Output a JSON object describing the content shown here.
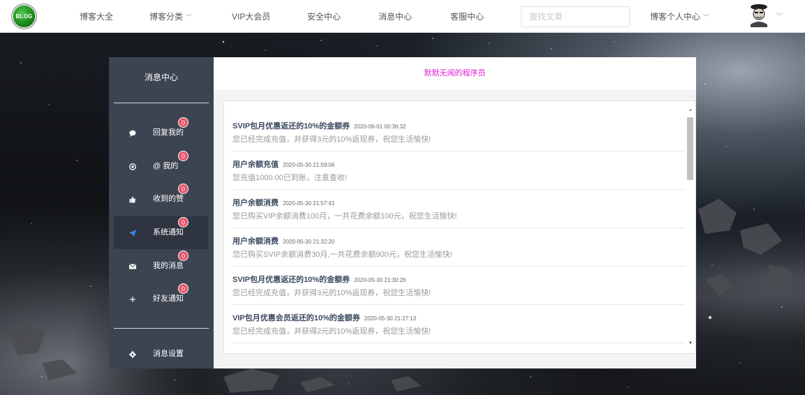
{
  "nav": {
    "logo_text": "BLOG",
    "items": [
      {
        "label": "博客大全",
        "has_caret": false
      },
      {
        "label": "博客分类",
        "has_caret": true
      },
      {
        "label": "VIP大会员",
        "has_caret": false
      },
      {
        "label": "安全中心",
        "has_caret": false
      },
      {
        "label": "消息中心",
        "has_caret": false
      },
      {
        "label": "客服中心",
        "has_caret": false
      }
    ],
    "caret_glyph": "﹀",
    "search_placeholder": "查找文章",
    "user_center_label": "博客个人中心",
    "avatar_icon": "user-avatar-icon"
  },
  "sidebar": {
    "title": "消息中心",
    "items": [
      {
        "label": "回复我的",
        "icon": "comment-icon",
        "badge": "0",
        "active": false
      },
      {
        "label": "@ 我的",
        "icon": "at-icon",
        "badge": "0",
        "active": false
      },
      {
        "label": "收到的赞",
        "icon": "thumbs-up-icon",
        "badge": "0",
        "active": false
      },
      {
        "label": "系统通知",
        "icon": "paper-plane-icon",
        "badge": "0",
        "active": true
      },
      {
        "label": "我的消息",
        "icon": "envelope-icon",
        "badge": "0",
        "active": false
      },
      {
        "label": "好友通知",
        "icon": "plus-icon",
        "badge": "0",
        "active": false
      }
    ],
    "settings_label": "消息设置",
    "settings_icon": "gear-icon"
  },
  "main": {
    "header": "默默无闻的程序员",
    "messages": [
      {
        "title": "SVIP包月优惠返还的10%的金额券",
        "time": "2020-06-01 00:36:32",
        "body": "您已经完成充值，并获得3元的10%返现券，祝您生活愉快!"
      },
      {
        "title": "用户余额充值",
        "time": "2020-05-30 21:59:06",
        "body": "您充值1000.00已到账，注意查收!"
      },
      {
        "title": "用户余额消费",
        "time": "2020-05-30 21:57:41",
        "body": "您已购买VIP余额消费100月，一共花费余额100元，祝您生活愉快!"
      },
      {
        "title": "用户余额消费",
        "time": "2020-05-30 21:32:20",
        "body": "您已购买SVIP余额消费30月,一共花费余额900元，祝您生活愉快!"
      },
      {
        "title": "SVIP包月优惠返还的10%的金额券",
        "time": "2020-05-30 21:30:26",
        "body": "您已经完成充值，并获得3元的10%返现券，祝您生活愉快!"
      },
      {
        "title": "VIP包月优惠会员返还的10%的金额券",
        "time": "2020-05-30 21:27:13",
        "body": "您已经完成充值，并获得2元的10%返现券，祝您生活愉快!"
      }
    ]
  },
  "colors": {
    "nav_bg": "#ffffff",
    "sidebar_bg": "#3d4451",
    "sidebar_active_bg": "#2e3440",
    "badge": "#e8556a",
    "header_text": "#e020d8",
    "msg_title": "#3b4a5e"
  }
}
